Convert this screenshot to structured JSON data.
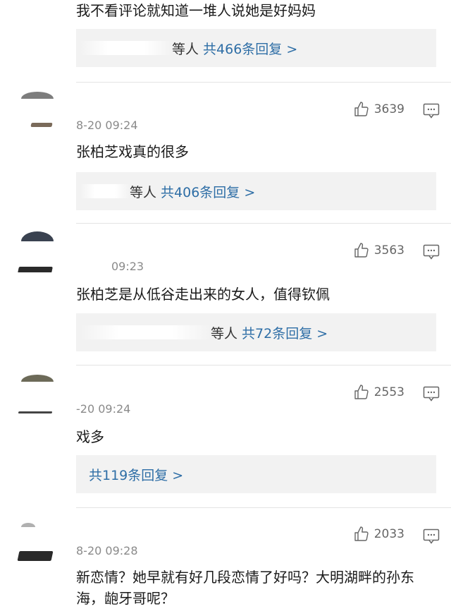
{
  "comments": [
    {
      "text": "我不看评论就知道一堆人说她是好妈妈",
      "reply_names": "等人",
      "reply_count": "共466条回复 >"
    },
    {
      "likes": "3639",
      "time": "8-20 09:24",
      "text": "张柏芝戏真的很多",
      "reply_names": "等人",
      "reply_count": "共406条回复 >"
    },
    {
      "likes": "3563",
      "time": "09:23",
      "text": "张柏芝是从低谷走出来的女人，值得钦佩",
      "reply_names": "等人",
      "reply_count": "共72条回复 >"
    },
    {
      "likes": "2553",
      "time": "-20 09:24",
      "text": "戏多",
      "reply_count": "共119条回复 >"
    },
    {
      "likes": "2033",
      "time": "8-20 09:28",
      "text": "新恋情？她早就有好几段恋情了好吗？大明湖畔的孙东海，龅牙哥呢？"
    }
  ],
  "icons": {
    "like": "thumbs-up-icon",
    "reply": "comment-icon"
  },
  "colors": {
    "link": "#2e6ea6",
    "meta": "#8a8a8a",
    "reply_bg": "#f2f2f2"
  }
}
